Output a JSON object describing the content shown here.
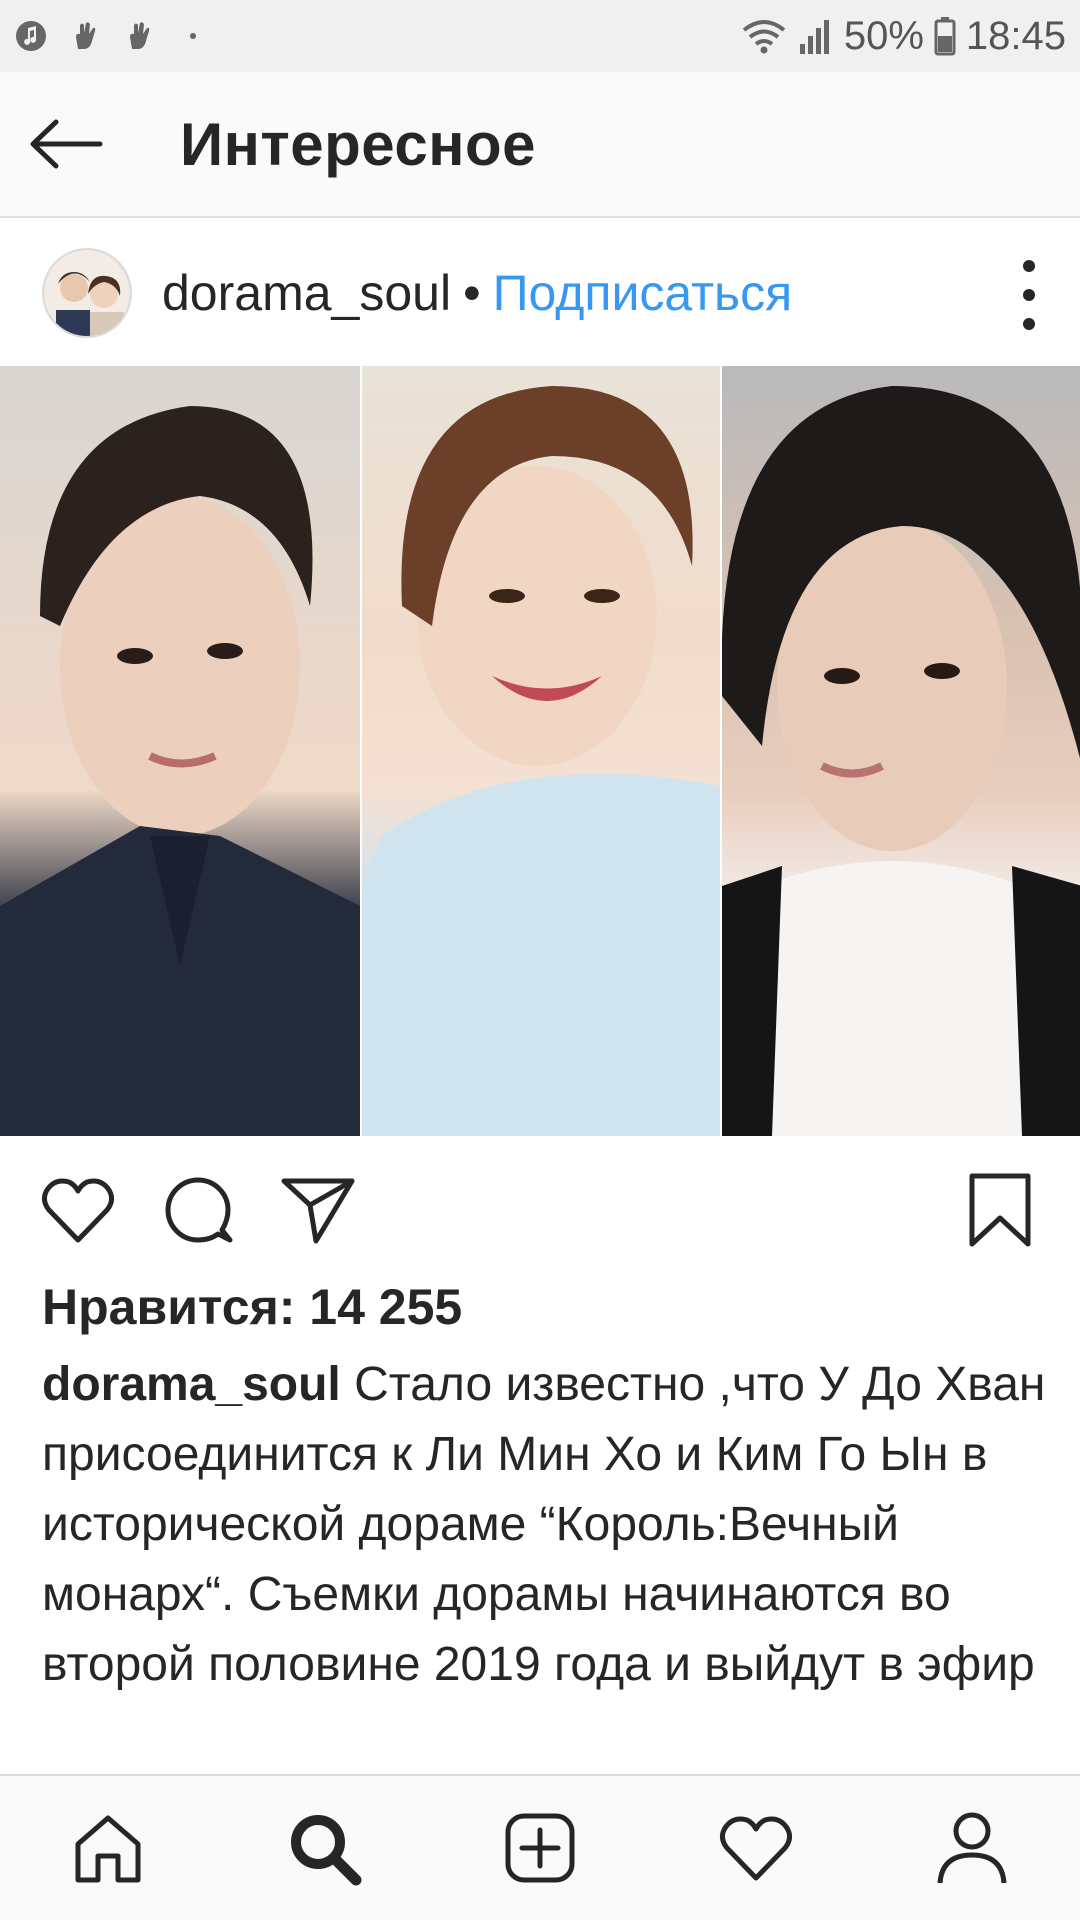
{
  "status_bar": {
    "battery": "50%",
    "time": "18:45",
    "icons": [
      "music-icon",
      "hand-icon",
      "hand-icon",
      "dot-icon",
      "wifi-icon",
      "signal-icon",
      "battery-icon"
    ]
  },
  "header": {
    "title": "Интересное",
    "back_icon": "arrow-left-icon"
  },
  "post": {
    "username": "dorama_soul",
    "separator": "•",
    "subscribe_label": "Подписаться",
    "more_icon": "more-vertical-icon",
    "image_panels": 3,
    "actions": {
      "like_icon": "heart-icon",
      "comment_icon": "comment-icon",
      "share_icon": "send-icon",
      "save_icon": "bookmark-icon"
    },
    "likes_text": "Нравится: 14 255",
    "caption_user": "dorama_soul",
    "caption_text": "Стало известно ,что У До Хван присоединится к Ли Мин Хо и Ким Го Ын в исторической дораме “Король:Вечный монарх“. Съемки дорамы начинаются во второй половине 2019 года и выйдут в эфир"
  },
  "bottom_nav": {
    "items": [
      "home-icon",
      "search-icon",
      "add-icon",
      "activity-icon",
      "profile-icon"
    ]
  },
  "colors": {
    "link": "#3897f0",
    "text": "#262626",
    "status_bg": "#f0f0f0"
  }
}
